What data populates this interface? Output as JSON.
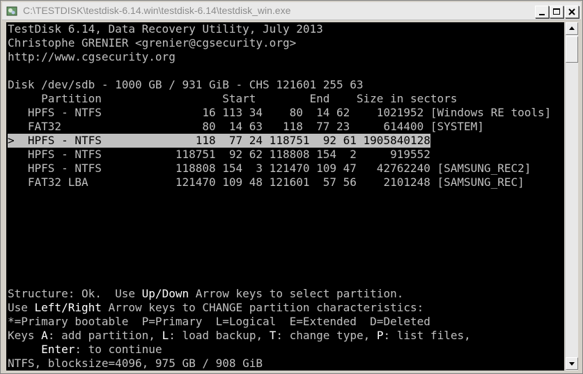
{
  "window": {
    "title": "C:\\TESTDISK\\testdisk-6.14.win\\testdisk-6.14\\testdisk_win.exe"
  },
  "console": {
    "header": [
      "TestDisk 6.14, Data Recovery Utility, July 2013",
      "Christophe GRENIER <grenier@cgsecurity.org>",
      "http://www.cgsecurity.org"
    ],
    "disk_line": "Disk /dev/sdb - 1000 GB / 931 GiB - CHS 121601 255 63",
    "table_header": "     Partition                  Start        End    Size in sectors",
    "partitions": [
      "   HPFS - NTFS               16 113 34    80  14 62    1021952 [Windows RE tools]",
      "   FAT32                     80  14 63   118  77 23     614400 [SYSTEM]",
      ">  HPFS - NTFS              118  77 24 118751  92 61 1905840128",
      "   HPFS - NTFS           118751  92 62 118808 154  2     919552",
      "   HPFS - NTFS           118808 154  3 121470 109 47   42762240 [SAMSUNG_REC2]",
      "   FAT32 LBA             121470 109 48 121601  57 56    2101248 [SAMSUNG_REC]"
    ],
    "selected_index": 2,
    "footer": {
      "l1a": "Structure: Ok.  Use ",
      "l1b": "Up",
      "l1c": "/",
      "l1d": "Down",
      "l1e": " Arrow keys to select partition.",
      "l2a": "Use ",
      "l2b": "Left",
      "l2c": "/",
      "l2d": "Right",
      "l2e": " Arrow keys to CHANGE partition characteristics:",
      "l3": "*=Primary bootable  P=Primary  L=Logical  E=Extended  D=Deleted",
      "l4a": "Keys ",
      "l4b": "A",
      "l4c": ": add partition, ",
      "l4d": "L",
      "l4e": ": load backup, ",
      "l4f": "T",
      "l4g": ": change type, ",
      "l4h": "P",
      "l4i": ": list files,",
      "l5a": "     ",
      "l5b": "Enter",
      "l5c": ": to continue",
      "l6": "NTFS, blocksize=4096, 975 GB / 908 GiB"
    }
  },
  "icons": {
    "app": "testdisk-app-icon",
    "minimize": "minimize-icon",
    "maximize": "maximize-icon",
    "close": "close-icon",
    "scroll_up": "arrow-up-icon",
    "scroll_down": "arrow-down-icon"
  }
}
